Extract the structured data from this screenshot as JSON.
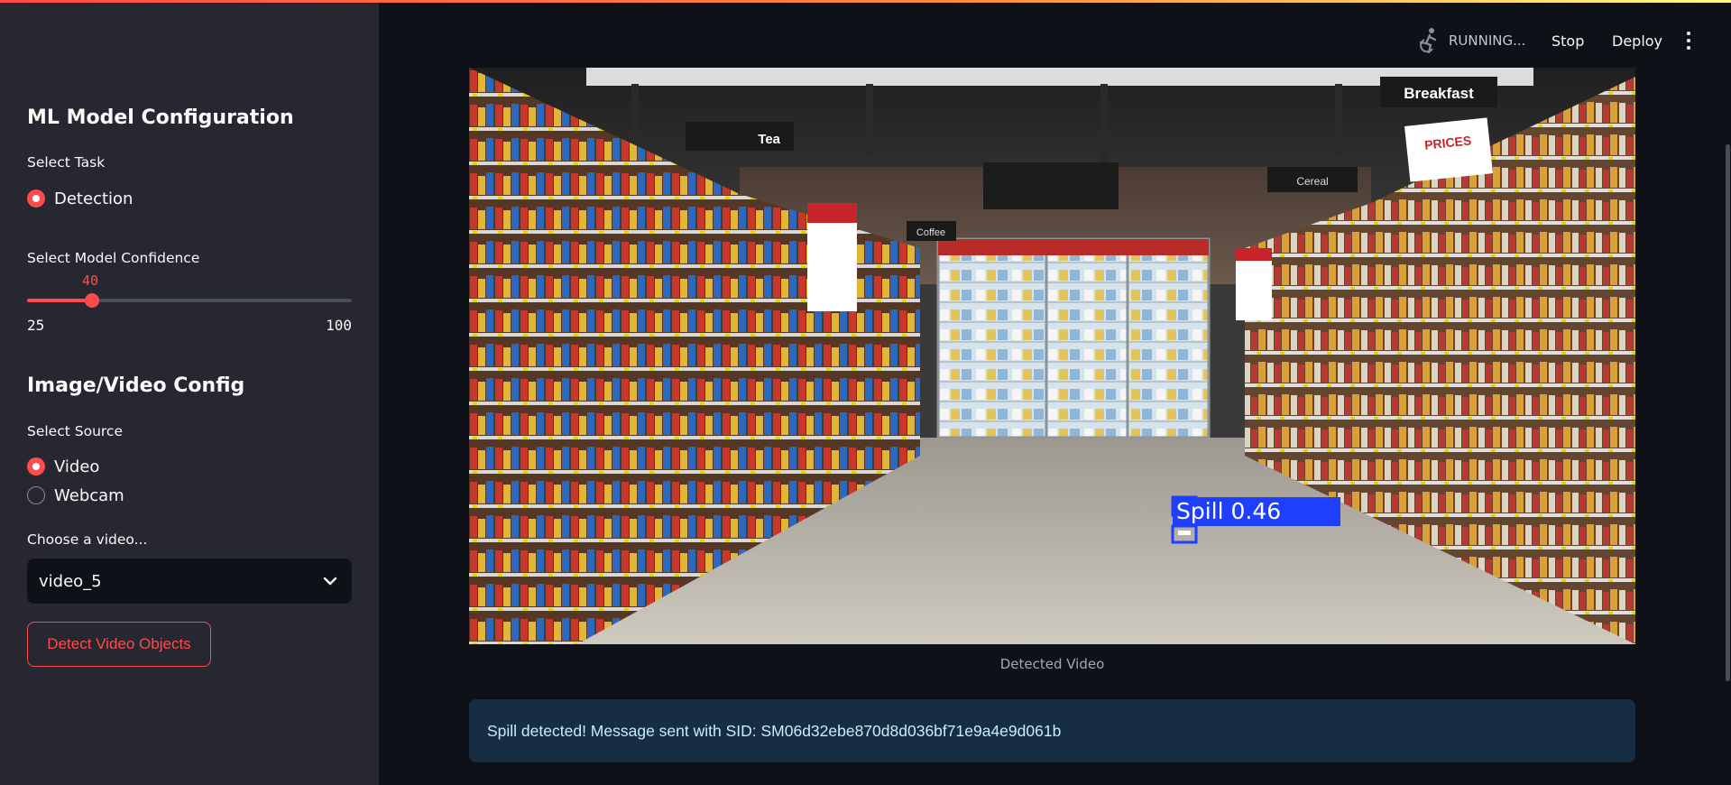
{
  "sidebar": {
    "model_heading": "ML Model Configuration",
    "task_label": "Select Task",
    "task_options": [
      {
        "label": "Detection",
        "selected": true
      }
    ],
    "confidence_label": "Select Model Confidence",
    "confidence": {
      "value": "40",
      "min": "25",
      "max": "100",
      "fraction": 0.2
    },
    "source_heading": "Image/Video Config",
    "source_label": "Select Source",
    "source_options": [
      {
        "label": "Video",
        "selected": true
      },
      {
        "label": "Webcam",
        "selected": false
      }
    ],
    "video_label": "Choose a video...",
    "video_selected": "video_5",
    "detect_button": "Detect Video Objects"
  },
  "header": {
    "status": "RUNNING...",
    "stop": "Stop",
    "deploy": "Deploy"
  },
  "main": {
    "store_signs": {
      "breakfast": "Breakfast",
      "tea": "Tea",
      "prices": "PRICES",
      "cereal": "Cereal",
      "coffee": "Coffee"
    },
    "detection_label": "Spill 0.46",
    "detection_confidence": 0.46,
    "caption": "Detected Video",
    "info_message": "Spill detected! Message sent with SID: SM06d32ebe870d8d036bf71e9a4e9d061b"
  },
  "colors": {
    "accent": "#ff4b4b",
    "sidebar_bg": "#262730",
    "main_bg": "#0e1117",
    "info_bg": "#172d43",
    "info_text": "#c7ebff",
    "detection_box": "#1f3fff"
  }
}
